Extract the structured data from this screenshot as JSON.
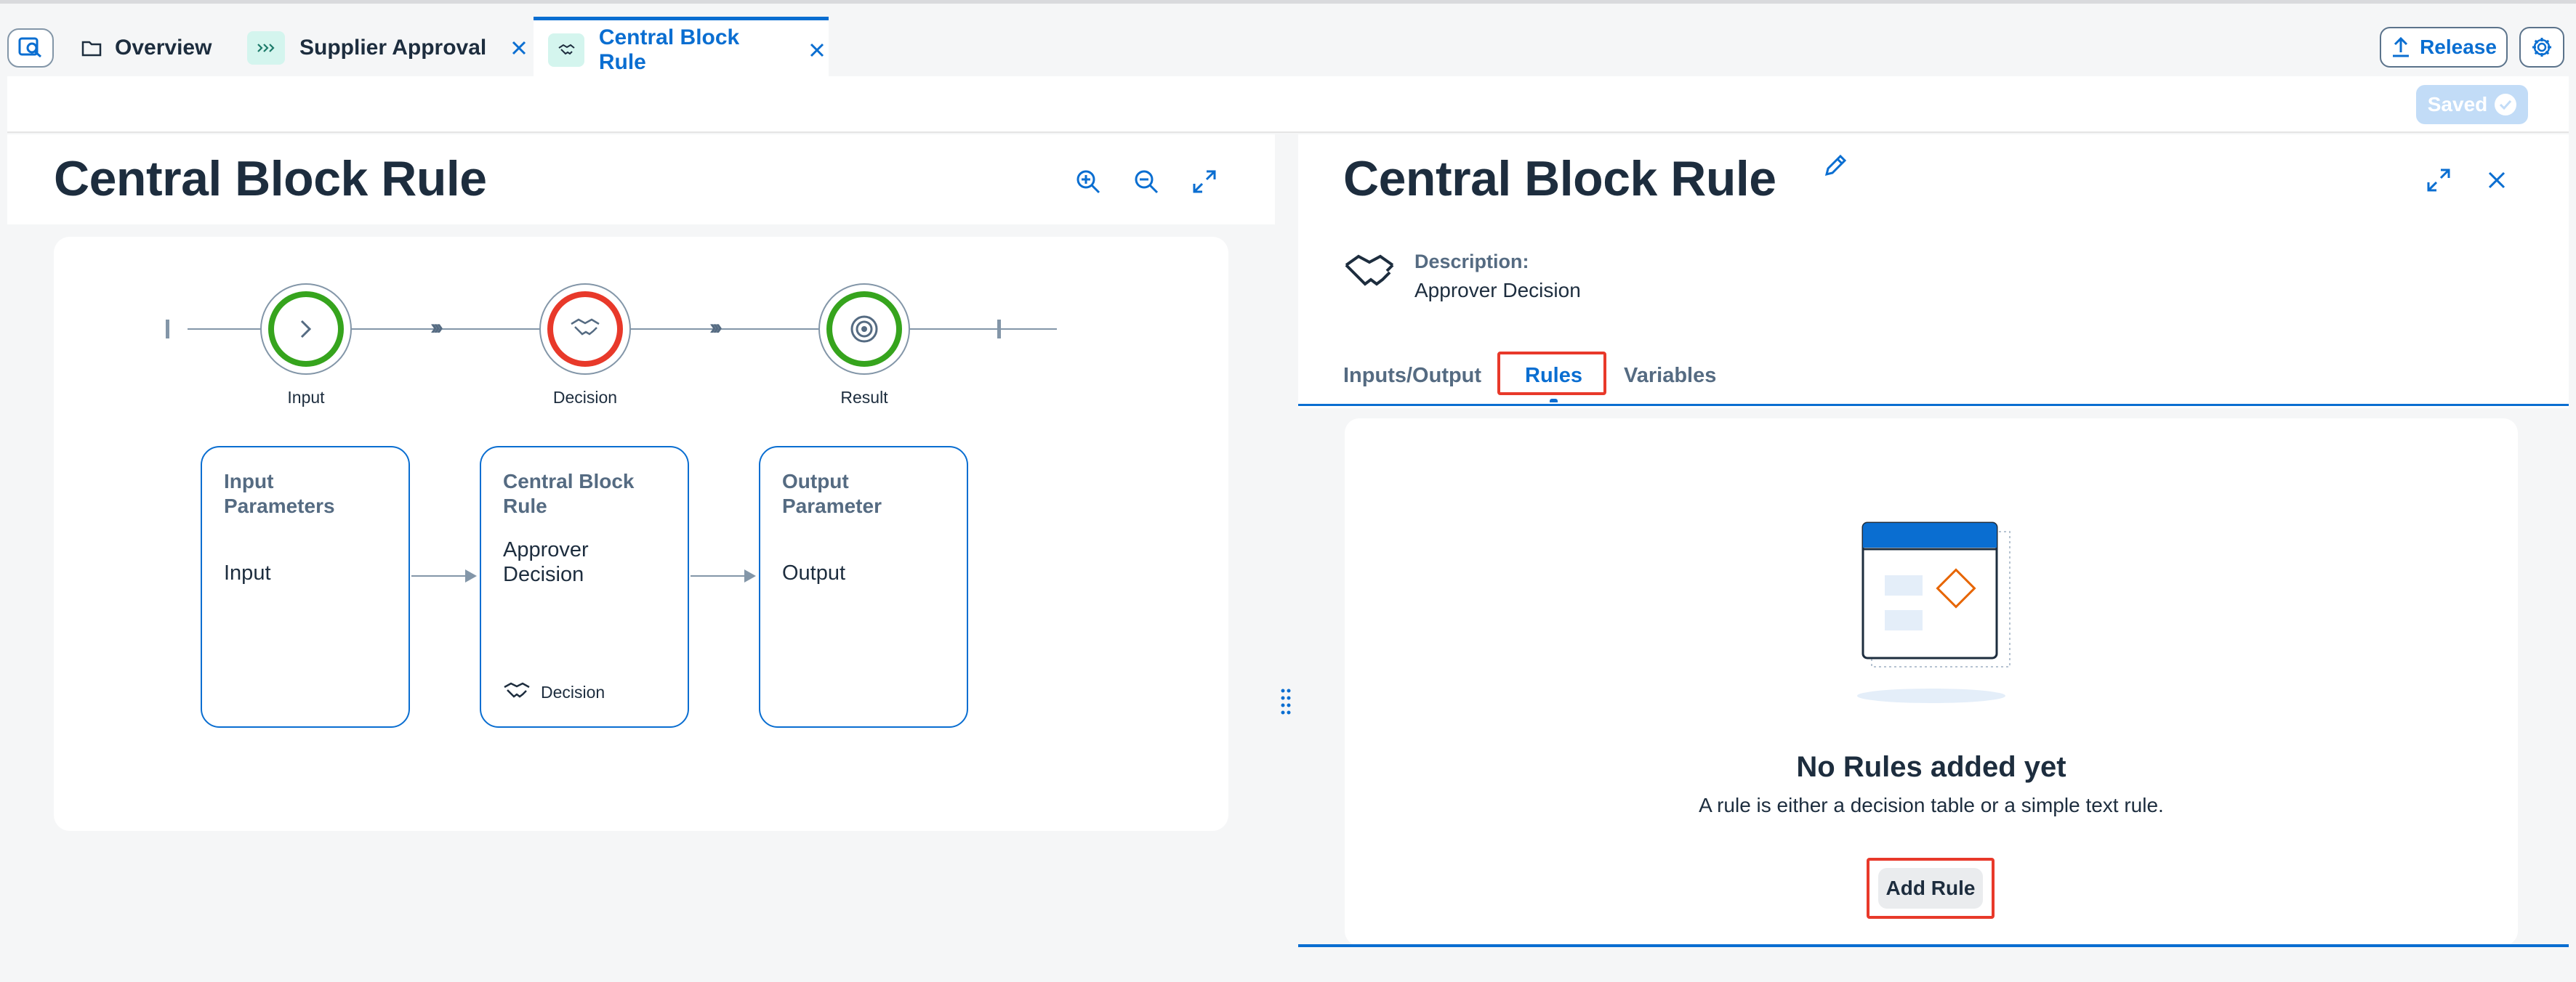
{
  "tabs": {
    "overview": "Overview",
    "supplier_approval": "Supplier Approval",
    "central_block_rule": "Central Block Rule"
  },
  "toolbar": {
    "release_label": "Release",
    "saved_label": "Saved"
  },
  "left": {
    "title": "Central Block Rule",
    "flow": {
      "input": "Input",
      "decision": "Decision",
      "result": "Result"
    },
    "cards": [
      {
        "header": "Input Parameters",
        "value": "Input",
        "footer": ""
      },
      {
        "header": "Central Block Rule",
        "value": "Approver Decision",
        "footer": "Decision"
      },
      {
        "header": "Output Parameter",
        "value": "Output",
        "footer": ""
      }
    ]
  },
  "right": {
    "title": "Central Block Rule",
    "description_label": "Description:",
    "description_value": "Approver Decision",
    "tabs": [
      "Inputs/Output",
      "Rules",
      "Variables"
    ],
    "selected_tab": "Rules",
    "empty_title": "No Rules added yet",
    "empty_text": "A rule is either a decision table or a simple text rule.",
    "add_rule_label": "Add Rule"
  },
  "colors": {
    "accent": "#0a6ed1",
    "success": "#36a41d",
    "error": "#e8392a",
    "highlight": "#e8392a"
  },
  "icons": [
    "search-doc-icon",
    "folder-icon",
    "chevrons-icon",
    "handshake-icon",
    "close-icon",
    "upload-icon",
    "gear-icon",
    "zoom-in-icon",
    "zoom-out-icon",
    "fullscreen-icon",
    "edit-icon",
    "check-icon",
    "target-icon",
    "grip-icon"
  ]
}
